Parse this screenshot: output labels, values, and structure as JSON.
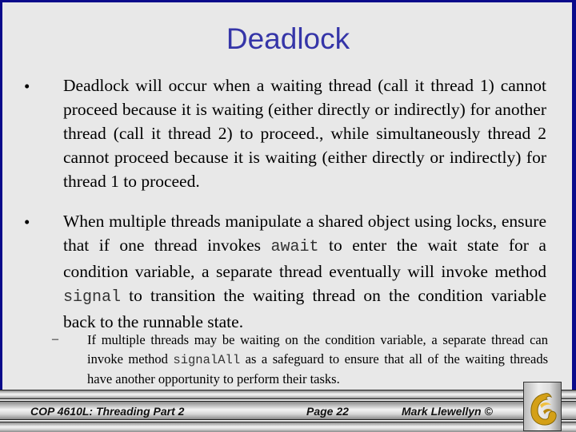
{
  "slide": {
    "title": "Deadlock",
    "bullets": [
      {
        "marker": "•",
        "text": "Deadlock will occur when a waiting thread (call it thread 1) cannot proceed because it is waiting (either directly or indirectly) for another thread (call it thread 2) to proceed., while simultaneously thread 2 cannot proceed because it is waiting (either directly or indirectly) for thread 1 to proceed."
      },
      {
        "marker": "•",
        "text_parts": [
          "When multiple threads manipulate a shared object using locks, ensure that if one thread invokes ",
          "await",
          " to enter the wait state for a condition variable, a separate thread eventually will invoke method ",
          "signal",
          " to transition the waiting thread on the condition variable back to the runnable state."
        ],
        "sub": {
          "marker": "–",
          "text_parts": [
            "If multiple threads may be waiting on the condition variable, a separate thread can invoke method ",
            "signalAll",
            " as a safeguard to ensure that all of the waiting threads have another opportunity to perform their tasks."
          ]
        }
      }
    ]
  },
  "footer": {
    "course": "COP 4610L: Threading Part 2",
    "page": "Page 22",
    "author": "Mark Llewellyn ©",
    "logo_icon": "pegasus-logo-icon"
  },
  "colors": {
    "border": "#0a0a8a",
    "title": "#3535a8",
    "background": "#e8e8e8",
    "logo_gold": "#d4a017"
  }
}
